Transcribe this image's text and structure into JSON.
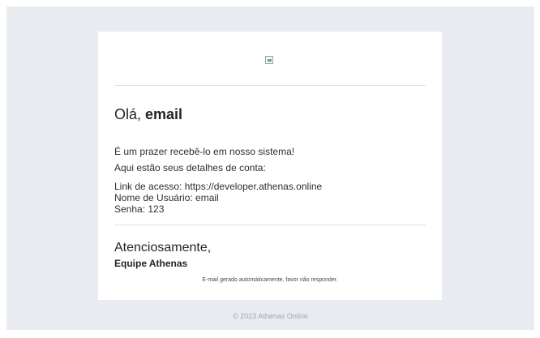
{
  "email": {
    "greeting_prefix": "Olá,",
    "greeting_name": "email",
    "welcome_text": "É um prazer recebê-lo em nosso sistema!",
    "details_intro": "Aqui estão seus detalhes de conta:",
    "access_link": "Link de acesso: https://developer.athenas.online",
    "username": "Nome de Usuário: email",
    "password": "Senha: 123",
    "closing": "Atenciosamente,",
    "team": "Equipe Athenas",
    "auto_note": "E-mail gerado automáticamente, favor não responder."
  },
  "footer": {
    "copyright": "© 2023 Athenas Online"
  },
  "logo_icon": "broken-image-icon"
}
